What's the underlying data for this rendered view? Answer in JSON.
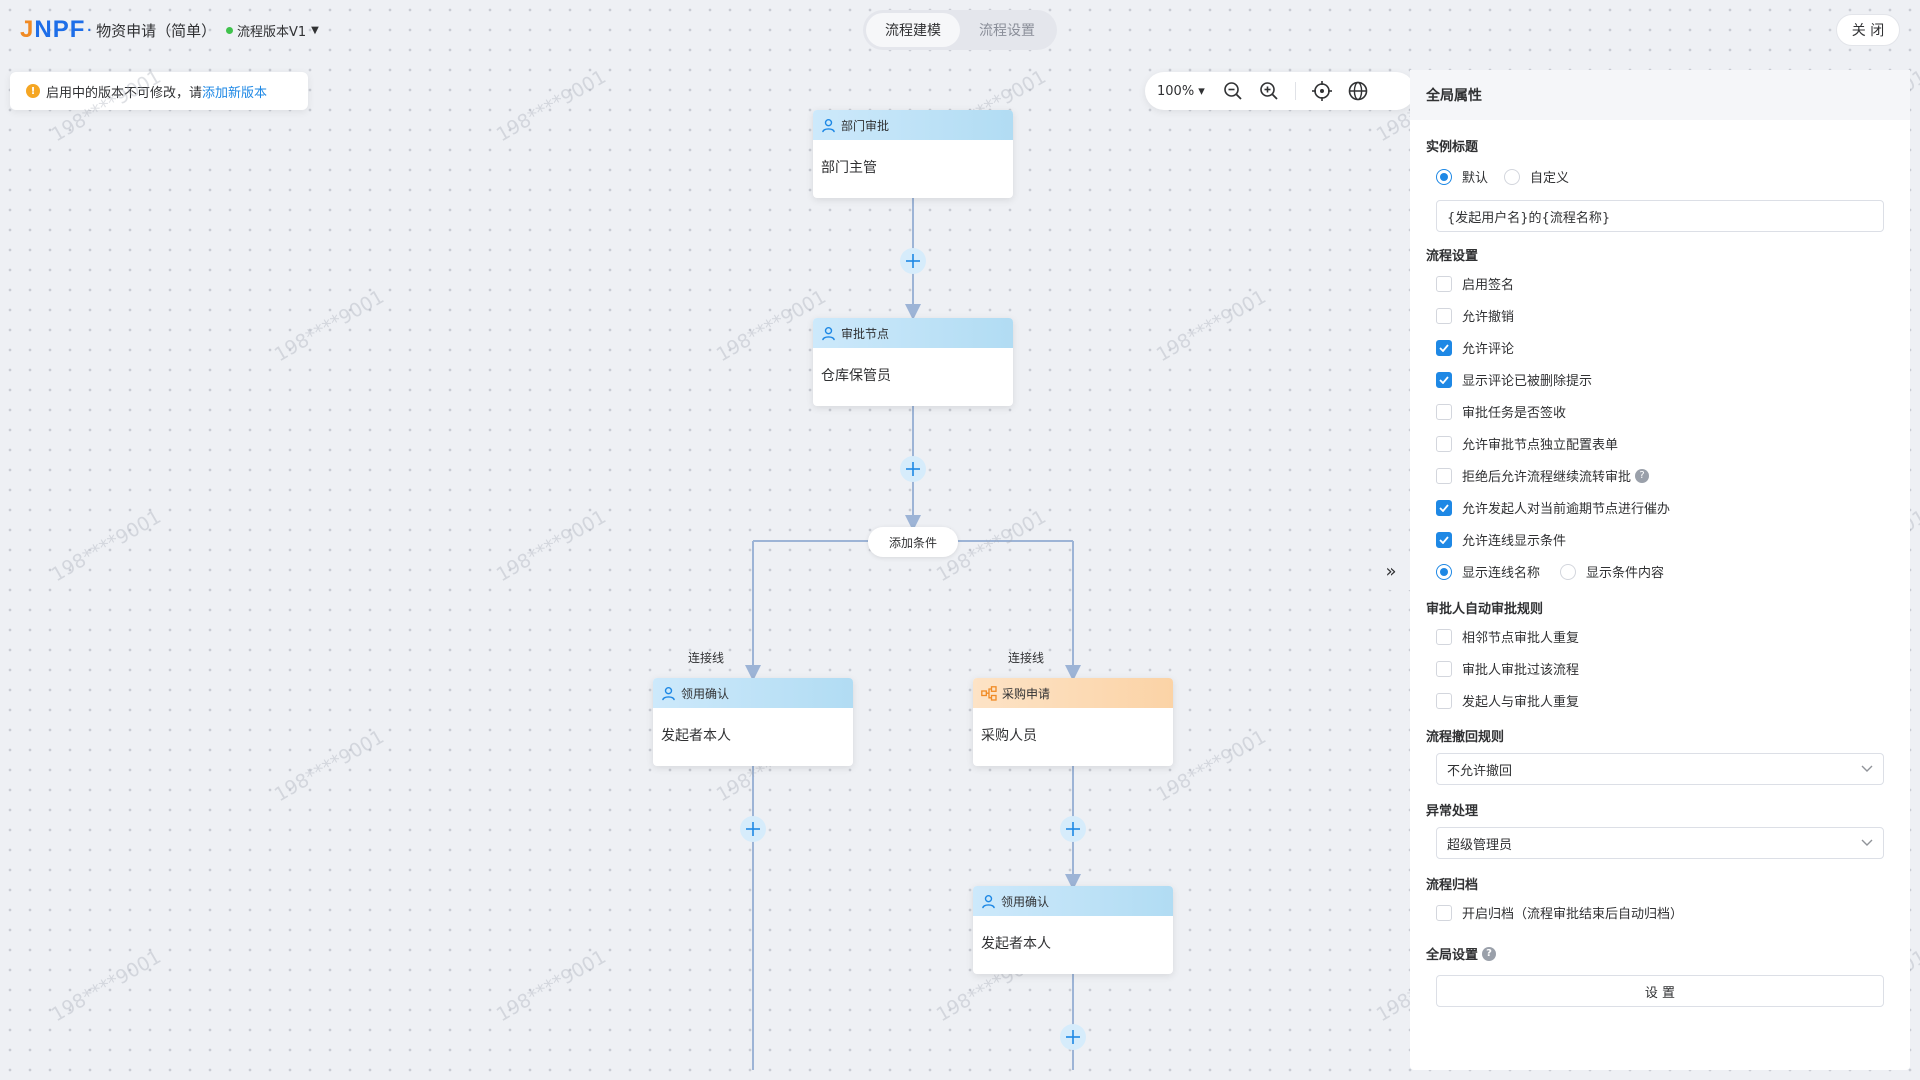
{
  "header": {
    "logo": "JNPF",
    "title": "物资申请（简单）",
    "version": "流程版本V1",
    "tabs": [
      {
        "label": "流程建模"
      },
      {
        "label": "流程设置"
      }
    ],
    "close_label": "关 闭"
  },
  "notice": {
    "text": "启用中的版本不可修改，请",
    "link": "添加新版本"
  },
  "zoom": {
    "value": "100%"
  },
  "flow": {
    "nodes": [
      {
        "type": "部门审批",
        "body": "部门主管"
      },
      {
        "type": "审批节点",
        "body": "仓库保管员"
      },
      {
        "type": "领用确认",
        "body": "发起者本人"
      },
      {
        "type": "采购申请",
        "body": "采购人员"
      },
      {
        "type": "领用确认",
        "body": "发起者本人"
      }
    ],
    "add_condition": "添加条件",
    "edge_labels": [
      "连接线",
      "连接线"
    ]
  },
  "watermark": "198****9001",
  "panel": {
    "title": "全局属性",
    "instance_title": {
      "label": "实例标题",
      "options": [
        "默认",
        "自定义"
      ],
      "selected": "默认",
      "value": "{发起用户名}的{流程名称}"
    },
    "flow_settings": {
      "label": "流程设置",
      "items": [
        {
          "label": "启用签名",
          "checked": false
        },
        {
          "label": "允许撤销",
          "checked": false
        },
        {
          "label": "允许评论",
          "checked": true
        },
        {
          "label": "显示评论已被删除提示",
          "checked": true
        },
        {
          "label": "审批任务是否签收",
          "checked": false
        },
        {
          "label": "允许审批节点独立配置表单",
          "checked": false
        },
        {
          "label": "拒绝后允许流程继续流转审批",
          "checked": false
        },
        {
          "label": "允许发起人对当前逾期节点进行催办",
          "checked": true
        },
        {
          "label": "允许连线显示条件",
          "checked": true
        }
      ],
      "line_display": [
        "显示连线名称",
        "显示条件内容"
      ],
      "line_display_selected": "显示连线名称"
    },
    "auto_approve": {
      "label": "审批人自动审批规则",
      "items": [
        {
          "label": "相邻节点审批人重复",
          "checked": false
        },
        {
          "label": "审批人审批过该流程",
          "checked": false
        },
        {
          "label": "发起人与审批人重复",
          "checked": false
        }
      ]
    },
    "withdraw": {
      "label": "流程撤回规则",
      "value": "不允许撤回"
    },
    "exception": {
      "label": "异常处理",
      "value": "超级管理员"
    },
    "archive": {
      "label": "流程归档",
      "item": "开启归档（流程审批结束后自动归档）",
      "checked": false
    },
    "global": {
      "label": "全局设置",
      "button": "设 置"
    }
  },
  "colors": {
    "primary": "#1e88e5",
    "node_blue": "#b1dcf3",
    "node_orange": "#fbd3a6",
    "line": "#9db4d6"
  }
}
